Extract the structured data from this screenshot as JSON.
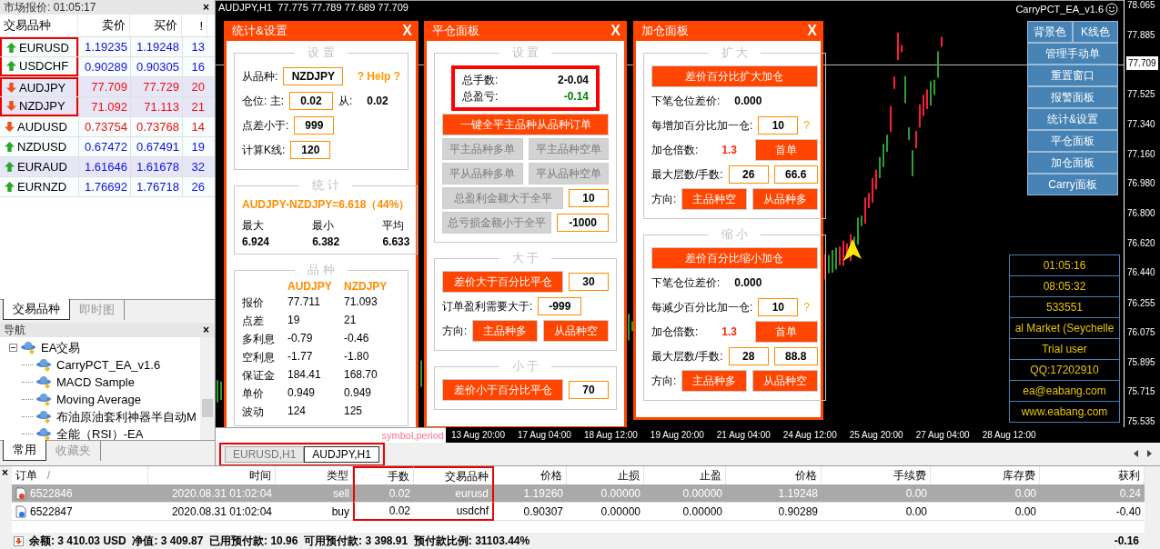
{
  "market_watch": {
    "title": "市场报价: 01:05:17",
    "close": "×",
    "columns": [
      "交易品种",
      "卖价",
      "买价",
      "!"
    ],
    "rows": [
      {
        "symbol": "EURUSD",
        "bid": "1.19235",
        "ask": "1.19248",
        "spread": "13",
        "rising": true,
        "selected": false,
        "boxed": true,
        "box_start": true
      },
      {
        "symbol": "USDCHF",
        "bid": "0.90289",
        "ask": "0.90305",
        "spread": "16",
        "rising": true,
        "selected": false,
        "boxed": true
      },
      {
        "symbol": "AUDJPY",
        "bid": "77.709",
        "ask": "77.729",
        "spread": "20",
        "rising": false,
        "selected": true,
        "boxed": true,
        "box_start": true
      },
      {
        "symbol": "NZDJPY",
        "bid": "71.092",
        "ask": "71.113",
        "spread": "21",
        "rising": false,
        "selected": true,
        "boxed": true
      },
      {
        "symbol": "AUDUSD",
        "bid": "0.73754",
        "ask": "0.73768",
        "spread": "14",
        "rising": false,
        "selected": false,
        "boxed": false
      },
      {
        "symbol": "NZDUSD",
        "bid": "0.67472",
        "ask": "0.67491",
        "spread": "19",
        "rising": true,
        "selected": false,
        "boxed": false
      },
      {
        "symbol": "EURAUD",
        "bid": "1.61646",
        "ask": "1.61678",
        "spread": "32",
        "rising": true,
        "selected": true,
        "boxed": false
      },
      {
        "symbol": "EURNZD",
        "bid": "1.76692",
        "ask": "1.76718",
        "spread": "26",
        "rising": true,
        "selected": false,
        "boxed": false
      }
    ],
    "tabs": [
      {
        "label": "交易品种",
        "selected": true
      },
      {
        "label": "即时图",
        "selected": false
      }
    ]
  },
  "navigator": {
    "title": "导航",
    "close": "×",
    "tree": [
      {
        "label": "EA交易",
        "expanded": true,
        "children": [
          {
            "label": "CarryPCT_EA_v1.6"
          },
          {
            "label": "MACD Sample"
          },
          {
            "label": "Moving Average"
          },
          {
            "label": "布油原油套利神器半自动M"
          },
          {
            "label": "全能（RSI）-EA"
          }
        ]
      }
    ],
    "tabs": [
      {
        "label": "常用",
        "selected": true
      },
      {
        "label": "收藏夹",
        "selected": false
      }
    ]
  },
  "chart": {
    "header": "AUDJPY,H1  77.775 77.789 77.689 77.709",
    "ea_label": "CarryPCT_EA_v1.6",
    "price_axis": [
      "78.065",
      "77.885",
      "77.525",
      "77.340",
      "77.160",
      "76.980",
      "76.800",
      "76.620",
      "76.440",
      "76.255",
      "76.075",
      "75.895",
      "75.715",
      "75.535"
    ],
    "current_price": "77.709",
    "time_axis": [
      "13 Aug 20:00",
      "17 Aug 04:00",
      "18 Aug 12:00",
      "19 Aug 20:00",
      "21 Aug 04:00",
      "24 Aug 12:00",
      "25 Aug 20:00",
      "27 Aug 04:00",
      "28 Aug 12:00"
    ],
    "object_label": "symbol,period",
    "side_buttons": [
      [
        "背景色",
        "K线色"
      ],
      [
        "管理手动单"
      ],
      [
        "重置窗口"
      ],
      [
        "报警面板"
      ],
      [
        "统计&设置"
      ],
      [
        "平仓面板"
      ],
      [
        "加仓面板"
      ],
      [
        "Carry面板"
      ]
    ],
    "info_lines": [
      "01:05:16",
      "08:05:32",
      "533551",
      "al Market (Seychelle",
      "Trial user",
      "QQ:17202910",
      "ea@eabang.com",
      "www.eabang.com"
    ],
    "panels": [
      {
        "title": "统计&设置",
        "close": "X",
        "sections": [
          {
            "legend": "设 置",
            "kind": "form",
            "rows": [
              {
                "items": [
                  {
                    "kind": "label",
                    "text": "从品种:"
                  },
                  {
                    "kind": "field",
                    "value": "NZDJPY"
                  },
                  {
                    "kind": "link",
                    "text": "? Help ?"
                  }
                ]
              },
              {
                "items": [
                  {
                    "kind": "label",
                    "text": "仓位: 主:"
                  },
                  {
                    "kind": "field",
                    "value": "0.02"
                  },
                  {
                    "kind": "label",
                    "text": "从:"
                  },
                  {
                    "kind": "value",
                    "text": "0.02"
                  }
                ]
              },
              {
                "items": [
                  {
                    "kind": "label",
                    "text": "点差小于:"
                  },
                  {
                    "kind": "field",
                    "value": "999"
                  }
                ]
              },
              {
                "items": [
                  {
                    "kind": "label",
                    "text": "计算K线:"
                  },
                  {
                    "kind": "field",
                    "value": "120"
                  }
                ]
              }
            ]
          },
          {
            "legend": "统 计",
            "kind": "stats",
            "headline": "AUDJPY-NZDJPY=6.618（44%）",
            "items": [
              {
                "label": "最大",
                "value": "6.924"
              },
              {
                "label": "最小",
                "value": "6.382"
              },
              {
                "label": "平均",
                "value": "6.633"
              }
            ]
          },
          {
            "legend": "品 种",
            "kind": "table",
            "header": [
              "AUDJPY",
              "NZDJPY"
            ],
            "rows": [
              [
                "报价",
                "77.711",
                "71.093"
              ],
              [
                "点差",
                "19",
                "21"
              ],
              [
                "多利息",
                "-0.79",
                "-0.46"
              ],
              [
                "空利息",
                "-1.77",
                "-1.80"
              ],
              [
                "保证金",
                "184.41",
                "168.70"
              ],
              [
                "单价",
                "0.949",
                "0.949"
              ],
              [
                "波动",
                "124",
                "125"
              ]
            ]
          }
        ]
      },
      {
        "title": "平仓面板",
        "close": "X",
        "sections": [
          {
            "legend": "设 置",
            "kind": "form",
            "rows": [
              {
                "items": [
                  {
                    "kind": "summary",
                    "annotated": true,
                    "lines": [
                      {
                        "label": "总手数:",
                        "value": "2-0.04",
                        "color": "#000000"
                      },
                      {
                        "label": "总盈亏:",
                        "value": "-0.14",
                        "color": "#008000"
                      }
                    ]
                  }
                ]
              },
              {
                "items": [
                  {
                    "kind": "button",
                    "label": "一键全平主品种从品种订单",
                    "disabled": false
                  }
                ]
              },
              {
                "items": [
                  {
                    "kind": "button",
                    "label": "平主品种多单",
                    "disabled": true
                  },
                  {
                    "kind": "button",
                    "label": "平主品种空单",
                    "disabled": true
                  }
                ]
              },
              {
                "items": [
                  {
                    "kind": "button",
                    "label": "平从品种多单",
                    "disabled": true
                  },
                  {
                    "kind": "button",
                    "label": "平从品种空单",
                    "disabled": true
                  }
                ]
              },
              {
                "items": [
                  {
                    "kind": "button",
                    "label": "总盈利金额大于全平",
                    "disabled": true
                  },
                  {
                    "kind": "field",
                    "value": "10"
                  }
                ]
              },
              {
                "items": [
                  {
                    "kind": "button",
                    "label": "总亏损金额小于全平",
                    "disabled": true
                  },
                  {
                    "kind": "field",
                    "value": "-1000"
                  }
                ]
              }
            ]
          },
          {
            "legend": "大 于",
            "kind": "form",
            "rows": [
              {
                "items": [
                  {
                    "kind": "button",
                    "label": "差价大于百分比平仓",
                    "disabled": false
                  },
                  {
                    "kind": "field",
                    "value": "30"
                  }
                ]
              },
              {
                "items": [
                  {
                    "kind": "label",
                    "text": "订单盈利需要大于:"
                  },
                  {
                    "kind": "field",
                    "value": "-999"
                  }
                ]
              },
              {
                "items": [
                  {
                    "kind": "label",
                    "text": "方向:"
                  },
                  {
                    "kind": "button",
                    "label": "主品种多",
                    "disabled": false
                  },
                  {
                    "kind": "button",
                    "label": "从品种空",
                    "disabled": false
                  }
                ]
              }
            ]
          },
          {
            "legend": "小 于",
            "kind": "form",
            "rows": [
              {
                "items": [
                  {
                    "kind": "button",
                    "label": "差价小于百分比平仓",
                    "disabled": false
                  },
                  {
                    "kind": "field",
                    "value": "70"
                  }
                ]
              }
            ]
          }
        ]
      },
      {
        "title": "加仓面板",
        "close": "X",
        "sections": [
          {
            "legend": "扩 大",
            "kind": "form",
            "rows": [
              {
                "items": [
                  {
                    "kind": "button",
                    "label": "差价百分比扩大加仓",
                    "disabled": false
                  }
                ]
              },
              {
                "items": [
                  {
                    "kind": "label",
                    "text": "下笔仓位差价:"
                  },
                  {
                    "kind": "value",
                    "text": "0.000"
                  }
                ]
              },
              {
                "items": [
                  {
                    "kind": "label",
                    "text": "每增加百分比加一仓:"
                  },
                  {
                    "kind": "field",
                    "value": "10"
                  },
                  {
                    "kind": "help",
                    "text": "?"
                  }
                ]
              },
              {
                "items": [
                  {
                    "kind": "label",
                    "text": "加仓倍数:"
                  },
                  {
                    "kind": "accent",
                    "text": "1.3"
                  },
                  {
                    "kind": "button",
                    "label": "首单",
                    "disabled": false
                  }
                ]
              },
              {
                "items": [
                  {
                    "kind": "label",
                    "text": "最大层数/手数:"
                  },
                  {
                    "kind": "field",
                    "value": "26"
                  },
                  {
                    "kind": "field",
                    "value": "66.6"
                  }
                ]
              },
              {
                "items": [
                  {
                    "kind": "label",
                    "text": "方向:"
                  },
                  {
                    "kind": "button",
                    "label": "主品种空",
                    "disabled": false
                  },
                  {
                    "kind": "button",
                    "label": "从品种多",
                    "disabled": false
                  }
                ]
              }
            ]
          },
          {
            "legend": "缩 小",
            "kind": "form",
            "rows": [
              {
                "items": [
                  {
                    "kind": "button",
                    "label": "差价百分比缩小加仓",
                    "disabled": false
                  }
                ]
              },
              {
                "items": [
                  {
                    "kind": "label",
                    "text": "下笔仓位差价:"
                  },
                  {
                    "kind": "value",
                    "text": "0.000"
                  }
                ]
              },
              {
                "items": [
                  {
                    "kind": "label",
                    "text": "每减少百分比加一仓:"
                  },
                  {
                    "kind": "field",
                    "value": "10"
                  },
                  {
                    "kind": "help",
                    "text": "?"
                  }
                ]
              },
              {
                "items": [
                  {
                    "kind": "label",
                    "text": "加仓倍数:"
                  },
                  {
                    "kind": "accent",
                    "text": "1.3"
                  },
                  {
                    "kind": "button",
                    "label": "首单",
                    "disabled": false
                  }
                ]
              },
              {
                "items": [
                  {
                    "kind": "label",
                    "text": "最大层数/手数:"
                  },
                  {
                    "kind": "field",
                    "value": "28"
                  },
                  {
                    "kind": "field",
                    "value": "88.8"
                  }
                ]
              },
              {
                "items": [
                  {
                    "kind": "label",
                    "text": "方向:"
                  },
                  {
                    "kind": "button",
                    "label": "主品种多",
                    "disabled": false
                  },
                  {
                    "kind": "button",
                    "label": "从品种空",
                    "disabled": false
                  }
                ]
              }
            ]
          }
        ]
      }
    ]
  },
  "chart_tabs": {
    "annotated": true,
    "tabs": [
      {
        "label": "EURUSD,H1",
        "selected": false
      },
      {
        "label": "AUDJPY,H1",
        "selected": true
      }
    ]
  },
  "terminal": {
    "close": "×",
    "columns": [
      {
        "label": "订单",
        "sort_mark": "/",
        "boxed": false
      },
      {
        "label": "时间",
        "boxed": false
      },
      {
        "label": "类型",
        "boxed": false
      },
      {
        "label": "手数",
        "boxed": true
      },
      {
        "label": "交易品种",
        "boxed": true
      },
      {
        "label": "价格",
        "boxed": false
      },
      {
        "label": "止损",
        "boxed": false
      },
      {
        "label": "止盈",
        "boxed": false
      },
      {
        "label": "价格",
        "boxed": false
      },
      {
        "label": "手续费",
        "boxed": false
      },
      {
        "label": "库存费",
        "boxed": false
      },
      {
        "label": "获利",
        "boxed": false
      }
    ],
    "rows": [
      {
        "cells": [
          "6522846",
          "2020.08.31 01:02:04",
          "sell",
          "0.02",
          "eurusd",
          "1.19260",
          "0.00000",
          "0.00000",
          "1.19248",
          "0.00",
          "0.00",
          "0.24"
        ],
        "short": true,
        "selected": true
      },
      {
        "cells": [
          "6522847",
          "2020.08.31 01:02:04",
          "buy",
          "0.02",
          "usdchf",
          "0.90307",
          "0.00000",
          "0.00000",
          "0.90289",
          "0.00",
          "0.00",
          "-0.40"
        ],
        "short": false,
        "selected": false
      }
    ],
    "status": "余额: 3 410.03 USD  净值: 3 409.87  已用预付款: 10.96  可用预付款: 3 398.91  预付款比例: 31103.44%",
    "total": "-0.16"
  }
}
